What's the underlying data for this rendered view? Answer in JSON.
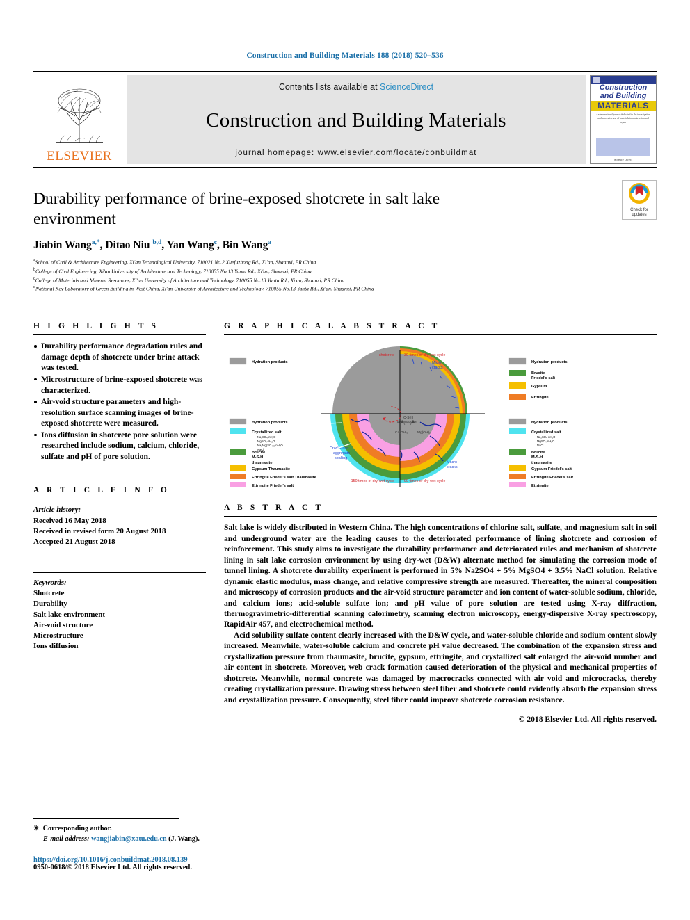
{
  "running_head": "Construction and Building Materials 188 (2018) 520–536",
  "masthead": {
    "contents_prefix": "Contents lists available at ",
    "sciencedirect": "ScienceDirect",
    "journal_title": "Construction and Building Materials",
    "homepage": "journal homepage: www.elsevier.com/locate/conbuildmat",
    "publisher": "ELSEVIER",
    "publisher_logo_name": "elsevier-tree-logo",
    "cover": {
      "line1": "Construction",
      "line2": "and Building",
      "line3": "MATERIALS",
      "blurb": "An international journal dedicated to the investigation and innovative use of materials in construction and repair",
      "foot": "Science Direct"
    }
  },
  "article": {
    "title": "Durability performance of brine-exposed shotcrete in salt lake environment",
    "authors": [
      {
        "name": "Jiabin Wang",
        "sup": "a,*"
      },
      {
        "name": "Ditao Niu",
        "sup": "b,d"
      },
      {
        "name": "Yan Wang",
        "sup": "c"
      },
      {
        "name": "Bin Wang",
        "sup": "a"
      }
    ],
    "affiliations": [
      {
        "sup": "a",
        "text": "School of Civil & Architecture Engineering, Xi'an Technological University, 710021 No.2 Xuefuzhong Rd., Xi'an, Shaanxi, PR China"
      },
      {
        "sup": "b",
        "text": "College of Civil Engineering, Xi'an University of Architecture and Technology, 710055 No.13 Yanta Rd., Xi'an, Shaanxi, PR China"
      },
      {
        "sup": "c",
        "text": "College of Materials and Mineral Resources, Xi'an University of Architecture and Technology, 710055 No.13 Yanta Rd., Xi'an, Shaanxi, PR China"
      },
      {
        "sup": "d",
        "text": "National Key Laboratory of Green Building in West China, Xi'an University of Architecture and Technology, 710055 No.13 Yanta Rd., Xi'an, Shaanxi, PR China"
      }
    ],
    "crossmark": {
      "line1": "Check for",
      "line2": "updates",
      "icon": "crossmark-check-for-updates-icon"
    }
  },
  "highlights": {
    "heading": "H I G H L I G H T S",
    "items": [
      "Durability performance degradation rules and damage depth of shotcrete under brine attack was tested.",
      "Microstructure of brine-exposed shotcrete was characterized.",
      "Air-void structure parameters and high-resolution surface scanning images of brine-exposed shotcrete were measured.",
      "Ions diffusion in shotcrete pore solution were researched include sodium, calcium, chloride, sulfate and pH of pore solution."
    ]
  },
  "article_info": {
    "heading": "A R T I C L E   I N F O",
    "history_label": "Article history:",
    "history": [
      "Received 16 May 2018",
      "Received in revised form 20 August 2018",
      "Accepted 21 August 2018"
    ],
    "keywords_label": "Keywords:",
    "keywords": [
      "Shotcrete",
      "Durability",
      "Salt lake environment",
      "Air-void structure",
      "Microstructure",
      "Ions diffusion"
    ]
  },
  "graphical_abstract": {
    "heading": "G R A P H I C A L   A B S T R A C T",
    "center_labels": {
      "shotcrete": "shotcrete",
      "cycles_top": "30 times of dry-wet cycle",
      "cycles_left": "150 times of dry-wet cycle",
      "cycles_right": "90 times of dry-wet cycle",
      "micro_cracks": "Micro cracks",
      "macro_cracks": "Macro cracks",
      "cracks_spalling": "Cracks and aggregate spalling",
      "csh": "C-S-H",
      "decomposition": "decomposition",
      "caoh": "Ca(OH)₂",
      "mgoh": "Mg(OH)₂"
    },
    "legend_top_left": [
      {
        "color": "#9b9b9b",
        "label": "Hydration products"
      }
    ],
    "legend_top_right": [
      {
        "color": "#9b9b9b",
        "label": "Hydration products"
      },
      {
        "color": "#4a9b3c",
        "label": "Brucite\nFriedel's salt"
      },
      {
        "color": "#f5bf00",
        "label": "Gypsum"
      },
      {
        "color": "#ef7c25",
        "label": "Ettringite"
      }
    ],
    "legend_bottom_left": [
      {
        "color": "#9b9b9b",
        "label": "Hydration products"
      },
      {
        "color": "#4fe3ef",
        "label": "Crystallized salt",
        "sub": [
          "Na₂SO₄·nH₂O",
          "MgSO₄·nH₂O",
          "Na₂Mg(SO₄)₂·nH₂O",
          "NaCl"
        ]
      },
      {
        "color": "#4a9b3c",
        "label": "Brucite\nM-S-H\nthaumasite"
      },
      {
        "color": "#f5bf00",
        "label": "Gypsum  Thaumasite"
      },
      {
        "color": "#ef7c25",
        "label": "Ettringite  Friedel's salt Thaumasite"
      },
      {
        "color": "#f9a0e3",
        "label": "Ettringite  Friedel's salt"
      }
    ],
    "legend_bottom_right": [
      {
        "color": "#9b9b9b",
        "label": "Hydration products"
      },
      {
        "color": "#4fe3ef",
        "label": "Crystallized salt",
        "sub": [
          "Na₂SO₄·nH₂O",
          "MgSO₄·nH₂O",
          "NaCl"
        ]
      },
      {
        "color": "#4a9b3c",
        "label": "Brucite\nM-S-H\nthaumasite"
      },
      {
        "color": "#f5bf00",
        "label": "Gypsum Friedel's salt"
      },
      {
        "color": "#ef7c25",
        "label": "Ettringite  Friedel's salt"
      },
      {
        "color": "#f9a0e3",
        "label": "Ettringite"
      }
    ]
  },
  "abstract": {
    "heading": "A B S T R A C T",
    "paragraphs": [
      "Salt lake is widely distributed in Western China. The high concentrations of chlorine salt, sulfate, and magnesium salt in soil and underground water are the leading causes to the deteriorated performance of lining shotcrete and corrosion of reinforcement. This study aims to investigate the durability performance and deteriorated rules and mechanism of shotcrete lining in salt lake corrosion environment by using dry-wet (D&W) alternate method for simulating the corrosion mode of tunnel lining. A shotcrete durability experiment is performed in 5% Na2SO4 + 5% MgSO4 + 3.5% NaCl solution. Relative dynamic elastic modulus, mass change, and relative compressive strength are measured. Thereafter, the mineral composition and microscopy of corrosion products and the air-void structure parameter and ion content of water-soluble sodium, chloride, and calcium ions; acid-soluble sulfate ion; and pH value of pore solution are tested using X-ray diffraction, thermogravimetric-differential scanning calorimetry, scanning electron microscopy, energy-dispersive X-ray spectroscopy, RapidAir 457, and electrochemical method.",
      "Acid solubility sulfate content clearly increased with the D&W cycle, and water-soluble chloride and sodium content slowly increased. Meanwhile, water-soluble calcium and concrete pH value decreased. The combination of the expansion stress and crystallization pressure from thaumasite, brucite, gypsum, ettringite, and crystallized salt enlarged the air-void number and air content in shotcrete. Moreover, web crack formation caused deterioration of the physical and mechanical properties of shotcrete. Meanwhile, normal concrete was damaged by macrocracks connected with air void and microcracks, thereby creating crystallization pressure. Drawing stress between steel fiber and shotcrete could evidently absorb the expansion stress and crystallization pressure. Consequently, steel fiber could improve shotcrete corrosion resistance."
    ],
    "copyright": "© 2018 Elsevier Ltd. All rights reserved."
  },
  "footer": {
    "corresponding": "Corresponding author.",
    "email_label": "E-mail address:",
    "email": "wangjiabin@xatu.edu.cn",
    "email_owner": "(J. Wang).",
    "doi": "https://doi.org/10.1016/j.conbuildmat.2018.08.139",
    "issn": "0950-0618/© 2018 Elsevier Ltd. All rights reserved."
  }
}
